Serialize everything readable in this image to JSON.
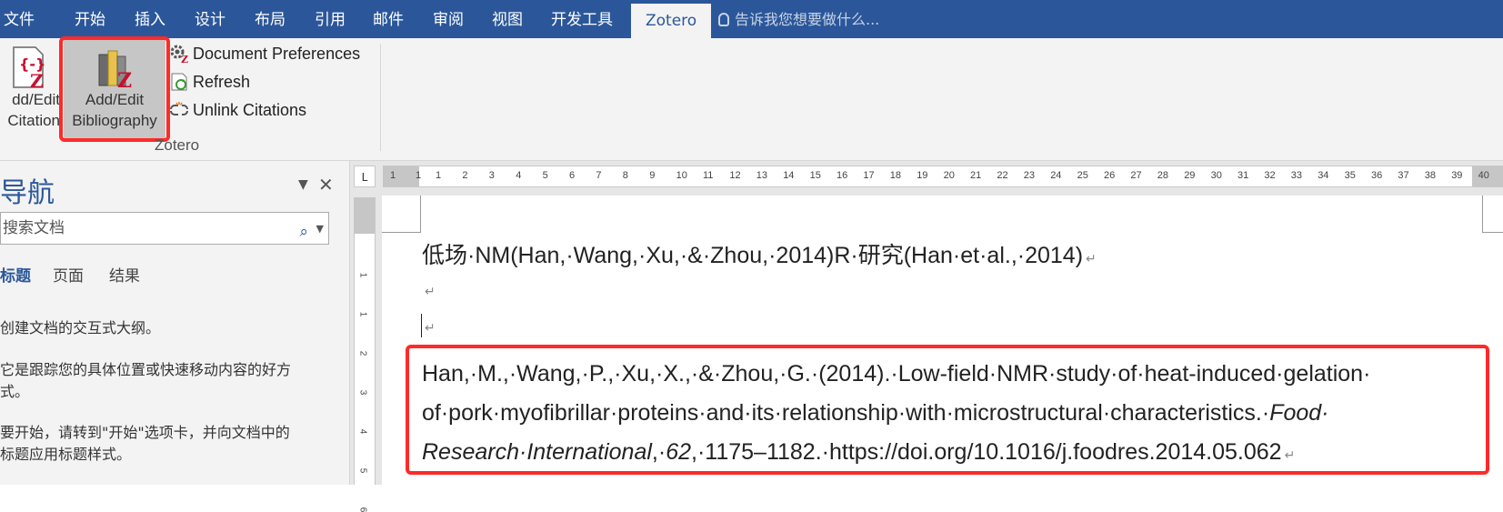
{
  "menu": {
    "file": "文件",
    "tabs": [
      "开始",
      "插入",
      "设计",
      "布局",
      "引用",
      "邮件",
      "审阅",
      "视图",
      "开发工具"
    ],
    "active_tab": "Zotero",
    "tell_me": "告诉我您想要做什么..."
  },
  "ribbon": {
    "add_edit_citation": "dd/Edit\nCitation",
    "add_edit_bibliography_line1": "Add/Edit",
    "add_edit_bibliography_line2": "Bibliography",
    "citation_line1": "dd/Edit",
    "citation_line2": "Citation",
    "document_preferences": "Document Preferences",
    "refresh": "Refresh",
    "unlink_citations": "Unlink Citations",
    "group_label": "Zotero"
  },
  "nav": {
    "title": "导航",
    "search_placeholder": "搜索文档",
    "tabs": [
      "标题",
      "页面",
      "结果"
    ],
    "text1": "创建文档的交互式大纲。",
    "text2a": "它是跟踪您的具体位置或快速移动内容的好方",
    "text2b": "式。",
    "text3a": "要开始，请转到\"开始\"选项卡，并向文档中的",
    "text3b": "标题应用标题样式。"
  },
  "ruler": {
    "corner": "L",
    "ticks": [
      "1",
      "1",
      "1",
      "2",
      "3",
      "4",
      "5",
      "6",
      "7",
      "8",
      "9",
      "10",
      "11",
      "12",
      "13",
      "14",
      "15",
      "16",
      "17",
      "18",
      "19",
      "20",
      "21",
      "22",
      "23",
      "24",
      "25",
      "26",
      "27",
      "28",
      "29",
      "30",
      "31",
      "32",
      "33",
      "34",
      "35",
      "36",
      "37",
      "38",
      "39",
      "40"
    ],
    "vticks": [
      "1",
      "1",
      "2",
      "3",
      "4",
      "5",
      "6"
    ]
  },
  "document": {
    "line1": "低场·NM(Han,·Wang,·Xu,·&·Zhou,·2014)R·研究(Han·et·al.,·2014)",
    "biblio_line1": "Han,·M.,·Wang,·P.,·Xu,·X.,·&·Zhou,·G.·(2014).·Low-field·NMR·study·of·heat-induced·gelation·",
    "biblio_line2a": "of·pork·myofibrillar·proteins·and·its·relationship·with·microstructural·characteristics.·",
    "biblio_line2b": "Food·",
    "biblio_line3a": "Research·International",
    "biblio_line3b": ",·",
    "biblio_line3c": "62",
    "biblio_line3d": ",·1175–1182.·https://doi.org/10.1016/j.foodres.2014.05.062",
    "para_mark": "↵"
  },
  "colors": {
    "menubar": "#2b579a",
    "highlight": "#ff2a2a"
  }
}
